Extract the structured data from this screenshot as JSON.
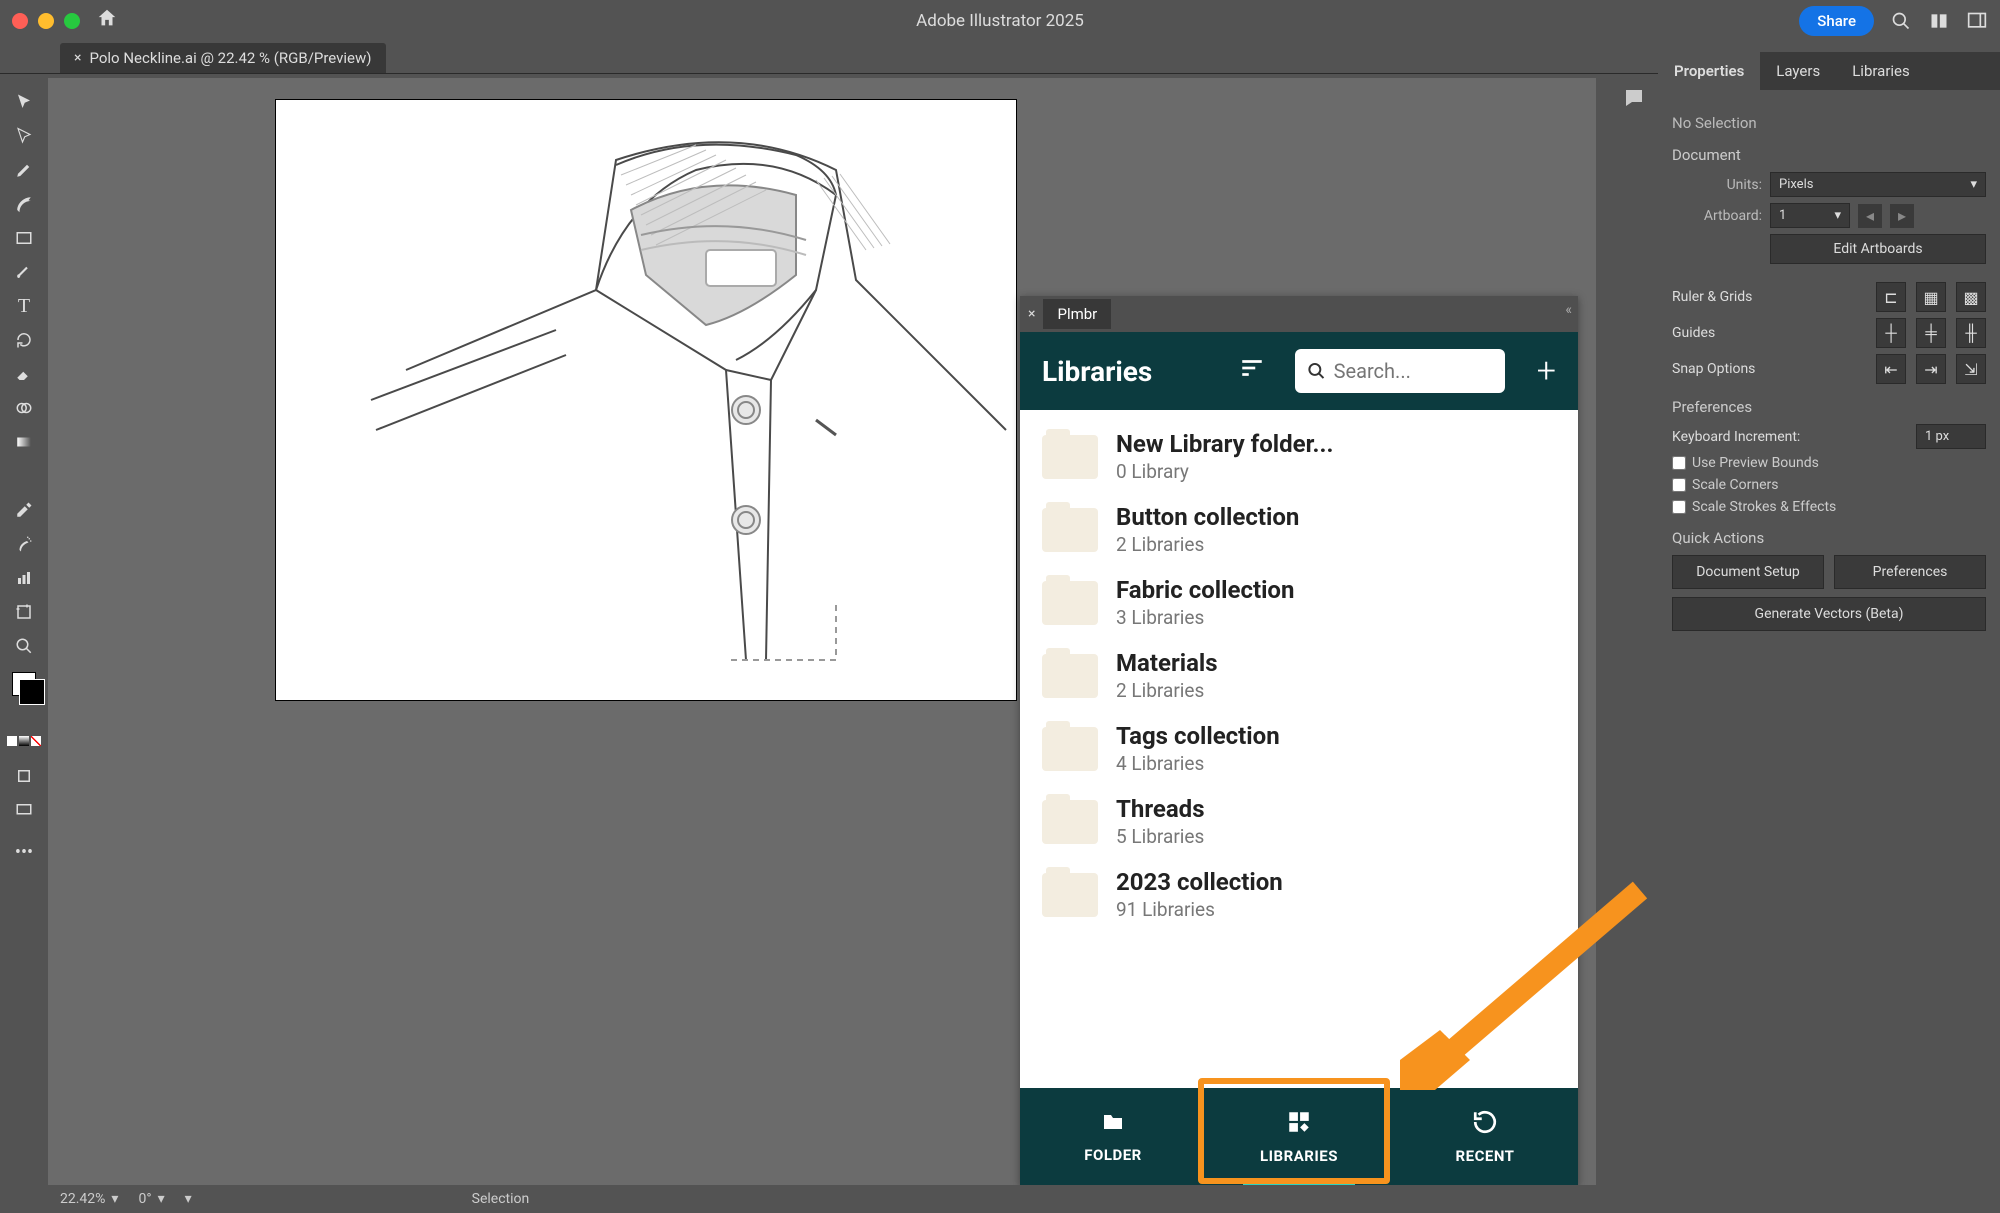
{
  "titlebar": {
    "app_title": "Adobe Illustrator 2025",
    "share_label": "Share"
  },
  "document_tab": {
    "label": "Polo Neckline.ai @ 22.42 % (RGB/Preview)"
  },
  "properties": {
    "tabs": [
      "Properties",
      "Layers",
      "Libraries"
    ],
    "no_selection": "No Selection",
    "document_label": "Document",
    "units_label": "Units:",
    "units_value": "Pixels",
    "artboard_label": "Artboard:",
    "artboard_value": "1",
    "edit_artboards": "Edit Artboards",
    "ruler_label": "Ruler & Grids",
    "guides_label": "Guides",
    "snap_label": "Snap Options",
    "prefs_label": "Preferences",
    "kb_incr_label": "Keyboard Increment:",
    "kb_incr_value": "1 px",
    "chk1": "Use Preview Bounds",
    "chk2": "Scale Corners",
    "chk3": "Scale Strokes & Effects",
    "quick_label": "Quick Actions",
    "btn_doc_setup": "Document Setup",
    "btn_prefs": "Preferences",
    "btn_generate": "Generate Vectors (Beta)"
  },
  "plmbr": {
    "tab": "Plmbr",
    "title": "Libraries",
    "search_placeholder": "Search...",
    "items": [
      {
        "name": "New Library folder...",
        "count": "0 Library"
      },
      {
        "name": "Button collection",
        "count": "2 Libraries"
      },
      {
        "name": "Fabric collection",
        "count": "3 Libraries"
      },
      {
        "name": "Materials",
        "count": "2 Libraries"
      },
      {
        "name": "Tags collection",
        "count": "4 Libraries"
      },
      {
        "name": "Threads",
        "count": "5 Libraries"
      },
      {
        "name": "2023 collection",
        "count": "91 Libraries"
      }
    ],
    "bottom_tabs": {
      "folder": "FOLDER",
      "libraries": "LIBRARIES",
      "recent": "RECENT"
    }
  },
  "statusbar": {
    "zoom": "22.42%",
    "rotate": "0°",
    "selection": "Selection"
  }
}
